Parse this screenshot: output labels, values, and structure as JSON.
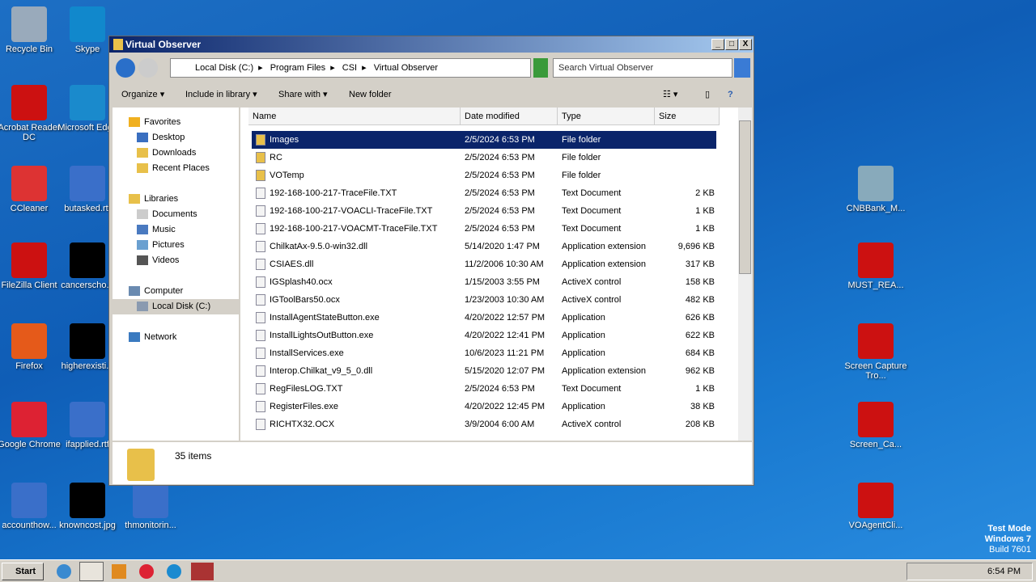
{
  "desktop": [
    "Recycle Bin",
    "Skype",
    "Acrobat Reader DC",
    "Microsoft Edge",
    "CCleaner",
    "butasked.rtf",
    "FileZilla Client",
    "cancerscho...",
    "Firefox",
    "higherexisti...",
    "Google Chrome",
    "ifapplied.rtf",
    "accounthow...",
    "knowncost.jpg",
    "thmonitorin...",
    "CNBBank_M...",
    "MUST_REA...",
    "Screen Capture Tro...",
    "Screen_Ca...",
    "VOAgentCli..."
  ],
  "window": {
    "title": "Virtual Observer",
    "min": "_",
    "max": "□",
    "close": "X"
  },
  "address": {
    "crumbs": [
      "Local Disk (C:)",
      "Program Files",
      "CSI",
      "Virtual Observer"
    ],
    "search_placeholder": "Search Virtual Observer"
  },
  "toolbar": {
    "organize": "Organize ▾",
    "include": "Include in library ▾",
    "share": "Share with ▾",
    "newfolder": "New folder"
  },
  "nav": {
    "favorites": "Favorites",
    "desktop": "Desktop",
    "downloads": "Downloads",
    "recent": "Recent Places",
    "libraries": "Libraries",
    "documents": "Documents",
    "music": "Music",
    "pictures": "Pictures",
    "videos": "Videos",
    "computer": "Computer",
    "localdisk": "Local Disk (C:)",
    "network": "Network"
  },
  "columns": {
    "name": "Name",
    "date": "Date modified",
    "type": "Type",
    "size": "Size"
  },
  "files": [
    [
      "Images",
      "2/5/2024 6:53 PM",
      "File folder",
      ""
    ],
    [
      "RC",
      "2/5/2024 6:53 PM",
      "File folder",
      ""
    ],
    [
      "VOTemp",
      "2/5/2024 6:53 PM",
      "File folder",
      ""
    ],
    [
      "192-168-100-217-TraceFile.TXT",
      "2/5/2024 6:53 PM",
      "Text Document",
      "2 KB"
    ],
    [
      "192-168-100-217-VOACLI-TraceFile.TXT",
      "2/5/2024 6:53 PM",
      "Text Document",
      "1 KB"
    ],
    [
      "192-168-100-217-VOACMT-TraceFile.TXT",
      "2/5/2024 6:53 PM",
      "Text Document",
      "1 KB"
    ],
    [
      "ChilkatAx-9.5.0-win32.dll",
      "5/14/2020 1:47 PM",
      "Application extension",
      "9,696 KB"
    ],
    [
      "CSIAES.dll",
      "11/2/2006 10:30 AM",
      "Application extension",
      "317 KB"
    ],
    [
      "IGSplash40.ocx",
      "1/15/2003 3:55 PM",
      "ActiveX control",
      "158 KB"
    ],
    [
      "IGToolBars50.ocx",
      "1/23/2003 10:30 AM",
      "ActiveX control",
      "482 KB"
    ],
    [
      "InstallAgentStateButton.exe",
      "4/20/2022 12:57 PM",
      "Application",
      "626 KB"
    ],
    [
      "InstallLightsOutButton.exe",
      "4/20/2022 12:41 PM",
      "Application",
      "622 KB"
    ],
    [
      "InstallServices.exe",
      "10/6/2023 11:21 PM",
      "Application",
      "684 KB"
    ],
    [
      "Interop.Chilkat_v9_5_0.dll",
      "5/15/2020 12:07 PM",
      "Application extension",
      "962 KB"
    ],
    [
      "RegFilesLOG.TXT",
      "2/5/2024 6:53 PM",
      "Text Document",
      "1 KB"
    ],
    [
      "RegisterFiles.exe",
      "4/20/2022 12:45 PM",
      "Application",
      "38 KB"
    ],
    [
      "RICHTX32.OCX",
      "3/9/2004 6:00 AM",
      "ActiveX control",
      "208 KB"
    ]
  ],
  "status": {
    "count": "35 items"
  },
  "taskbar": {
    "start": "Start",
    "time": "6:54 PM"
  },
  "watermark": {
    "line1": "Test Mode",
    "line2": "Windows 7",
    "line3": "Build 7601"
  }
}
